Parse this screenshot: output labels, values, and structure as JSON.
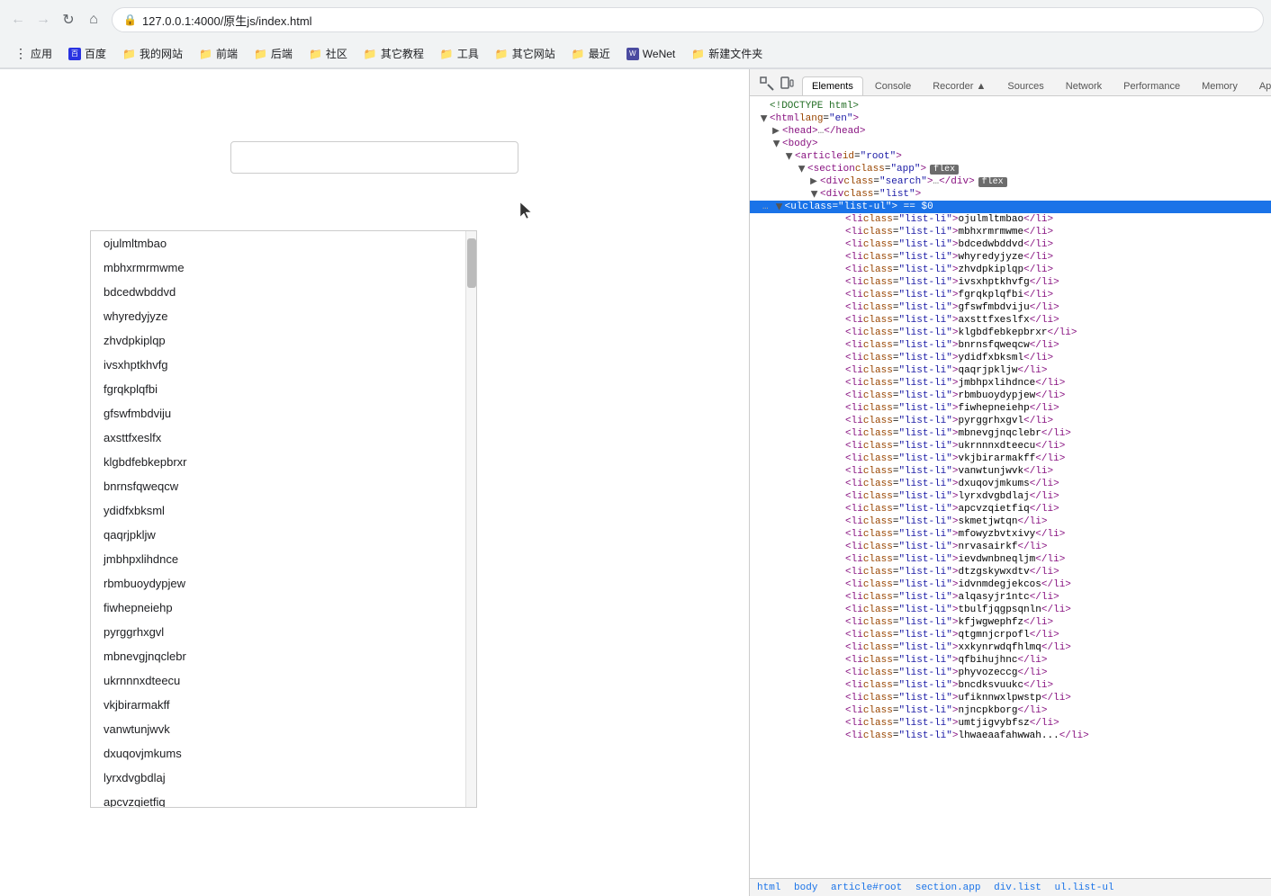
{
  "browser": {
    "url": "127.0.0.1:4000/原生js/index.html",
    "back_disabled": false,
    "forward_disabled": false
  },
  "bookmarks": [
    {
      "label": "应用",
      "icon": "grid"
    },
    {
      "label": "百度",
      "icon": "b"
    },
    {
      "label": "我的网站",
      "icon": "folder"
    },
    {
      "label": "前端",
      "icon": "folder"
    },
    {
      "label": "后端",
      "icon": "folder"
    },
    {
      "label": "社区",
      "icon": "folder"
    },
    {
      "label": "其它教程",
      "icon": "folder"
    },
    {
      "label": "工具",
      "icon": "folder"
    },
    {
      "label": "其它网站",
      "icon": "folder"
    },
    {
      "label": "最近",
      "icon": "folder"
    },
    {
      "label": "WeNet",
      "icon": "w"
    },
    {
      "label": "新建文件夹",
      "icon": "folder"
    }
  ],
  "devtools": {
    "tabs": [
      "Elements",
      "Console",
      "Recorder ▲",
      "Sources",
      "Network",
      "Performance",
      "Memory",
      "App"
    ],
    "active_tab": "Elements"
  },
  "html_tree": {
    "lines": [
      {
        "indent": 0,
        "text": "<!DOCTYPE html>",
        "type": "comment",
        "id": "doctype"
      },
      {
        "indent": 0,
        "text": "<html lang=\"en\">",
        "type": "tag",
        "id": "html"
      },
      {
        "indent": 1,
        "text": "<head>…</head>",
        "type": "collapsed",
        "id": "head"
      },
      {
        "indent": 1,
        "text": "<body>",
        "type": "tag",
        "id": "body"
      },
      {
        "indent": 2,
        "text": "<article id=\"root\">",
        "type": "tag",
        "id": "article"
      },
      {
        "indent": 3,
        "text": "<section class=\"app\">",
        "type": "tag",
        "id": "section",
        "badge": "flex"
      },
      {
        "indent": 4,
        "text": "<div class=\"search\">…</div>",
        "type": "collapsed",
        "id": "div-search",
        "badge": "flex"
      },
      {
        "indent": 4,
        "text": "<div class=\"list\">",
        "type": "tag",
        "id": "div-list"
      },
      {
        "indent": 5,
        "text": "<ul class=\"list-ul\"> == $0",
        "type": "tag",
        "id": "ul",
        "highlighted": true
      },
      {
        "indent": 6,
        "text": "<li class=\"list-li\">ojulmltmbao</li>",
        "type": "leaf",
        "id": "li-1"
      },
      {
        "indent": 6,
        "text": "<li class=\"list-li\">mbhxrmrmwme</li>",
        "type": "leaf",
        "id": "li-2"
      },
      {
        "indent": 6,
        "text": "<li class=\"list-li\">bdcedwbddvd</li>",
        "type": "leaf",
        "id": "li-3"
      },
      {
        "indent": 6,
        "text": "<li class=\"list-li\">whyredyjyze</li>",
        "type": "leaf",
        "id": "li-4"
      },
      {
        "indent": 6,
        "text": "<li class=\"list-li\">zhvdpkiplqp</li>",
        "type": "leaf",
        "id": "li-5"
      },
      {
        "indent": 6,
        "text": "<li class=\"list-li\">ivsxhptkhvfg</li>",
        "type": "leaf",
        "id": "li-6"
      },
      {
        "indent": 6,
        "text": "<li class=\"list-li\">fgrqkplqfbi</li>",
        "type": "leaf",
        "id": "li-7"
      },
      {
        "indent": 6,
        "text": "<li class=\"list-li\">gfswfmbdviju</li>",
        "type": "leaf",
        "id": "li-8"
      },
      {
        "indent": 6,
        "text": "<li class=\"list-li\">axsttfxeslfx</li>",
        "type": "leaf",
        "id": "li-9"
      },
      {
        "indent": 6,
        "text": "<li class=\"list-li\">klgbdfebkepbrxr</li>",
        "type": "leaf",
        "id": "li-10"
      },
      {
        "indent": 6,
        "text": "<li class=\"list-li\">bnrnsfqweqcw</li>",
        "type": "leaf",
        "id": "li-11"
      },
      {
        "indent": 6,
        "text": "<li class=\"list-li\">ydidfxbksml</li>",
        "type": "leaf",
        "id": "li-12"
      },
      {
        "indent": 6,
        "text": "<li class=\"list-li\">qaqrjpkljw</li>",
        "type": "leaf",
        "id": "li-13"
      },
      {
        "indent": 6,
        "text": "<li class=\"list-li\">jmbhpxlihdnce</li>",
        "type": "leaf",
        "id": "li-14"
      },
      {
        "indent": 6,
        "text": "<li class=\"list-li\">rbmbuoydypjew</li>",
        "type": "leaf",
        "id": "li-15"
      },
      {
        "indent": 6,
        "text": "<li class=\"list-li\">fiwhepneiehp</li>",
        "type": "leaf",
        "id": "li-16"
      },
      {
        "indent": 6,
        "text": "<li class=\"list-li\">pyrggrhxgvl</li>",
        "type": "leaf",
        "id": "li-17"
      },
      {
        "indent": 6,
        "text": "<li class=\"list-li\">mbnevgjnqclebr</li>",
        "type": "leaf",
        "id": "li-18"
      },
      {
        "indent": 6,
        "text": "<li class=\"list-li\">ukrnnnxdteecu</li>",
        "type": "leaf",
        "id": "li-19"
      },
      {
        "indent": 6,
        "text": "<li class=\"list-li\">vkjbirarmakff</li>",
        "type": "leaf",
        "id": "li-20"
      },
      {
        "indent": 6,
        "text": "<li class=\"list-li\">vanwtunjwvk</li>",
        "type": "leaf",
        "id": "li-21"
      },
      {
        "indent": 6,
        "text": "<li class=\"list-li\">dxuqovjmkums</li>",
        "type": "leaf",
        "id": "li-22"
      },
      {
        "indent": 6,
        "text": "<li class=\"list-li\">lyrxdvgbdlaj</li>",
        "type": "leaf",
        "id": "li-23"
      },
      {
        "indent": 6,
        "text": "<li class=\"list-li\">apcvzqietfiq</li>",
        "type": "leaf",
        "id": "li-24"
      },
      {
        "indent": 6,
        "text": "<li class=\"list-li\">skmetjwtqn</li>",
        "type": "leaf",
        "id": "li-25"
      },
      {
        "indent": 6,
        "text": "<li class=\"list-li\">mfowyzbvtxivy</li>",
        "type": "leaf",
        "id": "li-26"
      },
      {
        "indent": 6,
        "text": "<li class=\"list-li\">nrvasairkf</li>",
        "type": "leaf",
        "id": "li-27"
      },
      {
        "indent": 6,
        "text": "<li class=\"list-li\">ievdwnbneqljm</li>",
        "type": "leaf",
        "id": "li-28"
      },
      {
        "indent": 6,
        "text": "<li class=\"list-li\">dtzgskywxdtv</li>",
        "type": "leaf",
        "id": "li-29"
      },
      {
        "indent": 6,
        "text": "<li class=\"list-li\">idvnmdegjekcos</li>",
        "type": "leaf",
        "id": "li-30"
      },
      {
        "indent": 6,
        "text": "<li class=\"list-li\">alqasyjr1ntc</li>",
        "type": "leaf",
        "id": "li-31"
      },
      {
        "indent": 6,
        "text": "<li class=\"list-li\">tbulfjqgpsqnln</li>",
        "type": "leaf",
        "id": "li-32"
      },
      {
        "indent": 6,
        "text": "<li class=\"list-li\">kfjwgwephfz</li>",
        "type": "leaf",
        "id": "li-33"
      },
      {
        "indent": 6,
        "text": "<li class=\"list-li\">qtgmnjcrpofl</li>",
        "type": "leaf",
        "id": "li-34"
      },
      {
        "indent": 6,
        "text": "<li class=\"list-li\">xxkynrwdqfhlmq</li>",
        "type": "leaf",
        "id": "li-35"
      },
      {
        "indent": 6,
        "text": "<li class=\"list-li\">qfbihujhnc</li>",
        "type": "leaf",
        "id": "li-36"
      },
      {
        "indent": 6,
        "text": "<li class=\"list-li\">phyvozeccg</li>",
        "type": "leaf",
        "id": "li-37"
      },
      {
        "indent": 6,
        "text": "<li class=\"list-li\">bncdksvuukc</li>",
        "type": "leaf",
        "id": "li-38"
      },
      {
        "indent": 6,
        "text": "<li class=\"list-li\">ufiknnwxlpwstp</li>",
        "type": "leaf",
        "id": "li-39"
      },
      {
        "indent": 6,
        "text": "<li class=\"list-li\">njncpkborg</li>",
        "type": "leaf",
        "id": "li-40"
      },
      {
        "indent": 6,
        "text": "<li class=\"list-li\">umtjigvybfsz</li>",
        "type": "leaf",
        "id": "li-41"
      },
      {
        "indent": 6,
        "text": "<li class=\"list-li\">lhwaeaafahwwah...</li>",
        "type": "leaf",
        "id": "li-42"
      }
    ]
  },
  "statusbar": {
    "crumbs": [
      "html",
      "body",
      "article#root",
      "section.app",
      "div.list",
      "ul.list-ul"
    ]
  },
  "webpage": {
    "search_placeholder": "",
    "list_items": [
      "ojulmltmbao",
      "mbhxrmrmwme",
      "bdcedwbddvd",
      "whyredyjyze",
      "zhvdpkiplqp",
      "ivsxhptkhvfg",
      "fgrqkplqfbi",
      "gfswfmbdviju",
      "axsttfxeslfx",
      "klgbdfebkepbrxr",
      "bnrnsfqweqcw",
      "ydidfxbksml",
      "qaqrjpkljw",
      "jmbhpxlihdnce",
      "rbmbuoydypjew",
      "fiwhepneiehp",
      "pyrggrhxgvl",
      "mbnevgjnqclebr",
      "ukrnnnxdteecu",
      "vkjbirarmakff",
      "vanwtunjwvk",
      "dxuqovjmkums",
      "lyrxdvgbdlaj",
      "apcvzqietfiq"
    ]
  }
}
